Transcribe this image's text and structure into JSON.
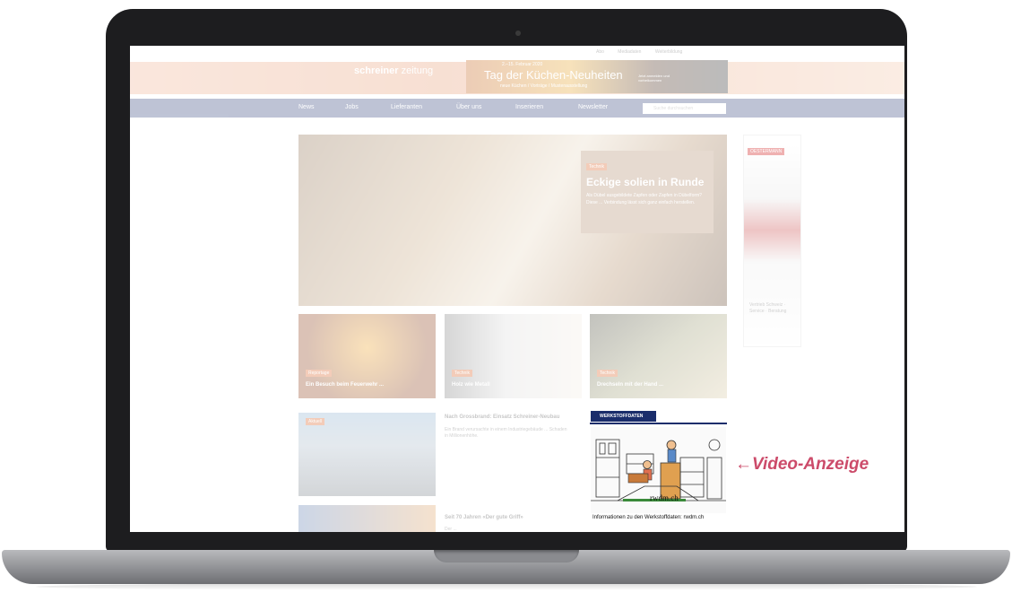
{
  "site": {
    "logo": "schreiner",
    "logo_suffix": "zeitung",
    "top_nav": [
      "Abo",
      "Mediadaten",
      "Weiterbildung"
    ],
    "banner": {
      "date": "2.–15. Februar 2020",
      "headline": "Tag der Küchen-Neuheiten",
      "sub": "neue Küchen / Vorträge / Musterausstellung",
      "right": "Jetzt anmelden und vorbeikommen"
    },
    "nav": [
      "News",
      "Jobs",
      "Lieferanten",
      "Über uns",
      "Inserieren",
      "Newsletter"
    ],
    "search_placeholder": "Suche durchsuchen",
    "hero": {
      "tag": "Technik",
      "title": "Eckige solien in Runde",
      "text": "Als Dübel ausgebildete Zapfen oder Zapfen in Dübelform? Diese ... Verbindung lässt sich ganz einfach herstellen."
    },
    "thumbs": [
      {
        "tag": "Reportage",
        "caption": "Ein Besuch beim Feuerwehr ..."
      },
      {
        "tag": "Technik",
        "caption": "Holz wie Metall"
      },
      {
        "tag": "Technik",
        "caption": "Drechseln mit der Hand ..."
      }
    ],
    "articles": [
      {
        "tag": "Aktuell",
        "title": "Nach Grossbrand: Einsatz Schreiner-Neubau",
        "text": "Ein Brand verursachte in einem Industriegebäude ... Schaden in Millionenhöhe."
      },
      {
        "title": "Seit 70 Jahren «Der gute Griff»",
        "text": "Der ..."
      }
    ],
    "side_ad": {
      "logo": "OESTERMANN",
      "text": "Vertrieb Schweiz · Service · Beratung"
    }
  },
  "ad_panel": {
    "tab": "WERKSTOFFDATEN",
    "brand": "rwdm.ch",
    "caption": "Informationen zu den Werkstoffdaten: rwdm.ch"
  },
  "video_label": "Video-Anzeige",
  "colors": {
    "nav": "#2a3c78",
    "accent": "#cc4b6a",
    "ad_tab": "#1a2d6b"
  }
}
